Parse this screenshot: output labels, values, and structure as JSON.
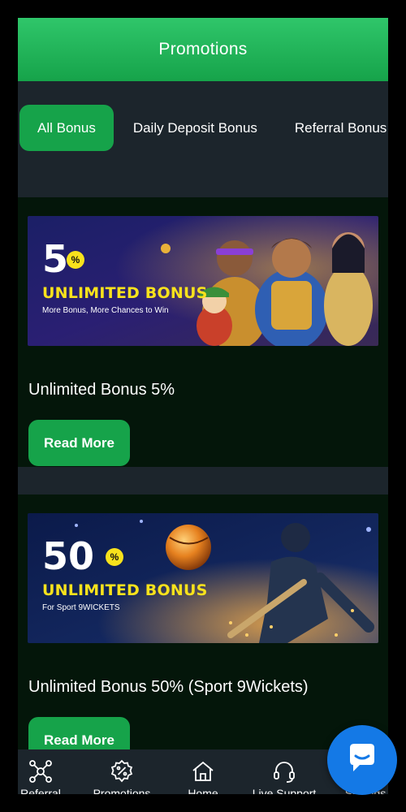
{
  "header": {
    "title": "Promotions"
  },
  "tabs": [
    {
      "label": "All Bonus",
      "active": true
    },
    {
      "label": "Daily Deposit Bonus",
      "active": false
    },
    {
      "label": "Referral Bonus",
      "active": false
    }
  ],
  "promotions": [
    {
      "banner": {
        "percent_number": "5",
        "percent_sign": "%",
        "headline": "UNLIMITED BONUS",
        "subline": "More Bonus, More Chances to Win"
      },
      "title": "Unlimited Bonus 5%",
      "button_label": "Read More"
    },
    {
      "banner": {
        "percent_number": "50",
        "percent_sign": "%",
        "headline": "UNLIMITED BONUS",
        "subline": "For Sport 9WICKETS"
      },
      "title": "Unlimited Bonus 50% (Sport 9Wickets)",
      "button_label": "Read More"
    }
  ],
  "bottom_nav": [
    {
      "label": "Referral",
      "icon": "referral-network-icon"
    },
    {
      "label": "Promotions",
      "icon": "promotions-percent-icon"
    },
    {
      "label": "Home",
      "icon": "home-icon"
    },
    {
      "label": "Live Support",
      "icon": "headset-icon"
    },
    {
      "label": "Settings",
      "icon": "settings-icon"
    }
  ],
  "chat_button": {
    "icon": "chat-bubble-icon"
  },
  "colors": {
    "brand_green": "#16a34a",
    "header_green": "#2fc66a",
    "card_background": "#04160a",
    "panel_background": "#1c252c",
    "bonus_yellow": "#f8e21c",
    "chat_blue": "#1479e6"
  }
}
